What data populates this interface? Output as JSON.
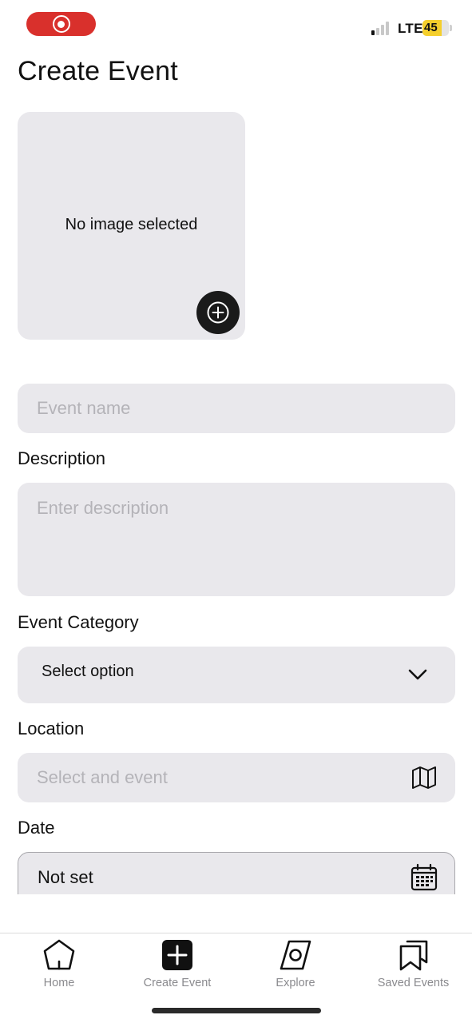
{
  "status_bar": {
    "network": "LTE",
    "battery": "45",
    "battery_level": 0.45,
    "signal_bars_active": 1,
    "signal_bars_total": 4,
    "recording_color": "#d9302c"
  },
  "page": {
    "title": "Create Event"
  },
  "image_picker": {
    "empty_text": "No image selected",
    "add_icon": "plus-circle-icon"
  },
  "form": {
    "event_name": {
      "placeholder": "Event name",
      "value": ""
    },
    "description": {
      "label": "Description",
      "placeholder": "Enter description",
      "value": ""
    },
    "category": {
      "label": "Event Category",
      "selected": "Select option",
      "icon": "chevron-down-icon"
    },
    "location": {
      "label": "Location",
      "placeholder": "Select and event",
      "icon": "map-icon"
    },
    "date": {
      "label": "Date",
      "value": "Not set",
      "icon": "calendar-icon"
    }
  },
  "tab_bar": {
    "tabs": [
      {
        "label": "Home",
        "icon": "home-icon"
      },
      {
        "label": "Create Event",
        "icon": "plus-square-icon"
      },
      {
        "label": "Explore",
        "icon": "compass-icon"
      },
      {
        "label": "Saved Events",
        "icon": "bookmarks-icon"
      }
    ]
  },
  "colors": {
    "field_bg": "#e9e8ec",
    "placeholder": "#b4b3b8",
    "tab_label": "#8a8a8e",
    "dark": "#1a1a1a"
  }
}
